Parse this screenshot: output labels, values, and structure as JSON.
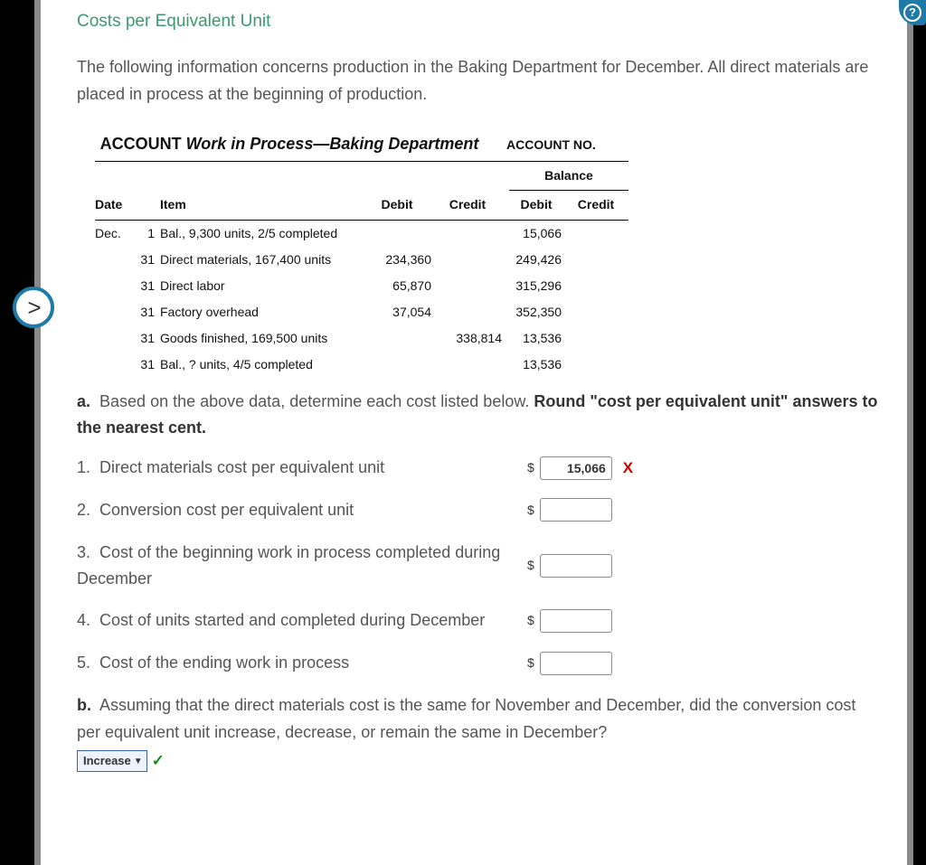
{
  "title": "Costs per Equivalent Unit",
  "intro": "The following information concerns production in the Baking Department for December. All direct materials are placed in process at the beginning of production.",
  "ledger": {
    "title_prefix": "ACCOUNT ",
    "title_italic": "Work in Process—Baking Department",
    "account_no_label": "ACCOUNT NO.",
    "headers": {
      "date": "Date",
      "item": "Item",
      "debit": "Debit",
      "credit": "Credit",
      "balance": "Balance",
      "bal_debit": "Debit",
      "bal_credit": "Credit"
    },
    "rows": [
      {
        "month": "Dec.",
        "day": "1",
        "item": "Bal., 9,300 units, 2/5 completed",
        "debit": "",
        "credit": "",
        "bdebit": "15,066",
        "bcredit": ""
      },
      {
        "month": "",
        "day": "31",
        "item": "Direct materials, 167,400 units",
        "debit": "234,360",
        "credit": "",
        "bdebit": "249,426",
        "bcredit": ""
      },
      {
        "month": "",
        "day": "31",
        "item": "Direct labor",
        "debit": "65,870",
        "credit": "",
        "bdebit": "315,296",
        "bcredit": ""
      },
      {
        "month": "",
        "day": "31",
        "item": "Factory overhead",
        "debit": "37,054",
        "credit": "",
        "bdebit": "352,350",
        "bcredit": ""
      },
      {
        "month": "",
        "day": "31",
        "item": "Goods finished, 169,500 units",
        "debit": "",
        "credit": "338,814",
        "bdebit": "13,536",
        "bcredit": ""
      },
      {
        "month": "",
        "day": "31",
        "item": "Bal., ? units, 4/5 completed",
        "debit": "",
        "credit": "",
        "bdebit": "13,536",
        "bcredit": ""
      }
    ]
  },
  "part_a": {
    "label": "a.",
    "text_before": "Based on the above data, determine each cost listed below. ",
    "text_bold": "Round \"cost per equivalent unit\" answers to the nearest cent."
  },
  "answers": [
    {
      "num": "1.",
      "text": "Direct materials cost per equivalent unit",
      "value": "15,066",
      "mark": "x"
    },
    {
      "num": "2.",
      "text": "Conversion cost per equivalent unit",
      "value": "",
      "mark": ""
    },
    {
      "num": "3.",
      "text": "Cost of the beginning work in process completed during December",
      "value": "",
      "mark": ""
    },
    {
      "num": "4.",
      "text": "Cost of units started and completed during December",
      "value": "",
      "mark": ""
    },
    {
      "num": "5.",
      "text": "Cost of the ending work in process",
      "value": "",
      "mark": ""
    }
  ],
  "dollar_sign": "$",
  "part_b": {
    "label": "b.",
    "text": "Assuming that the direct materials cost is the same for November and December, did the conversion cost per equivalent unit increase, decrease, or remain the same in December?"
  },
  "dropdown": {
    "selected": "Increase",
    "mark": "check"
  },
  "nav_arrow_glyph": ">",
  "help_glyph": "?"
}
